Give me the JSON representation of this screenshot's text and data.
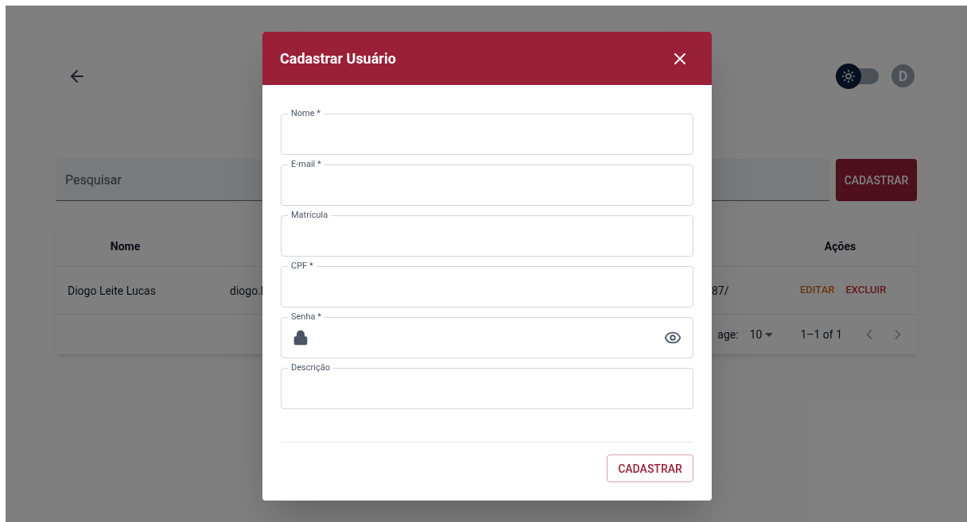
{
  "page": {
    "search": {
      "placeholder": "Pesquisar"
    },
    "add_button": "CADASTRAR",
    "theme_switch": {
      "on": false
    },
    "avatar": "D"
  },
  "table": {
    "columns": [
      "Nome",
      "Ações"
    ],
    "rows": [
      {
        "name": "Diogo Leite Lucas",
        "column_2": "diogo.l",
        "column_3": "87/",
        "actions": [
          "EDITAR",
          "EXCLUIR"
        ]
      }
    ],
    "footer": {
      "rows_label": "age:",
      "rows_value": "10",
      "range": "1–1 of 1"
    }
  },
  "dialog": {
    "title": "Cadastrar Usuário",
    "fields": [
      {
        "label": "Nome *",
        "kind": "text"
      },
      {
        "label": "E-mail *",
        "kind": "text"
      },
      {
        "label": "Matrícula",
        "kind": "text"
      },
      {
        "label": "CPF *",
        "kind": "text"
      },
      {
        "label": "Senha *",
        "kind": "password"
      },
      {
        "label": "Descrição",
        "kind": "text"
      }
    ],
    "submit": "CADASTRAR"
  }
}
